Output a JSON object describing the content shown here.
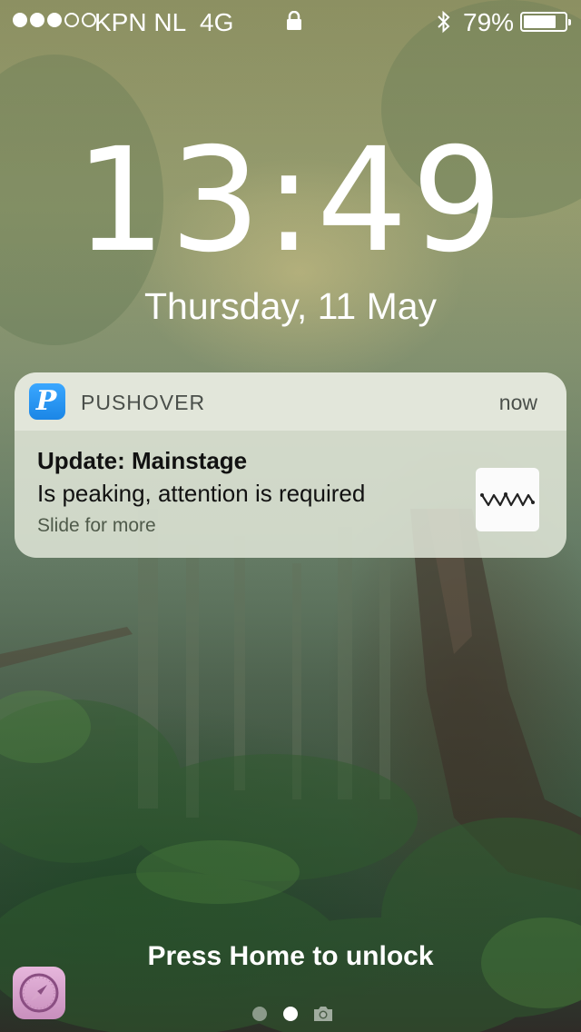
{
  "status_bar": {
    "signal_bars_filled": 3,
    "signal_bars_total": 5,
    "carrier": "KPN NL",
    "network": "4G",
    "lock_icon": "lock-icon",
    "bluetooth_icon": "bluetooth-icon",
    "battery_percent": "79%",
    "battery_level": 0.79
  },
  "clock": {
    "time": "13:49",
    "date": "Thursday, 11 May"
  },
  "notification": {
    "app_icon": "pushover-app-icon",
    "app_icon_letter": "P",
    "app_name": "PUSHOVER",
    "time": "now",
    "title": "Update: Mainstage",
    "body": "Is peaking, attention is required",
    "hint": "Slide for more",
    "thumbnail_icon": "waveform-thumbnail-icon"
  },
  "lock_screen": {
    "unlock_text": "Press Home to unlock",
    "suggested_app_icon": "safari-icon",
    "page_indicator": {
      "pages": 2,
      "current": 2,
      "camera_icon": "camera-icon"
    }
  },
  "colors": {
    "app_icon_blue": "#2196f3",
    "notification_bg": "#e1e6d8"
  }
}
